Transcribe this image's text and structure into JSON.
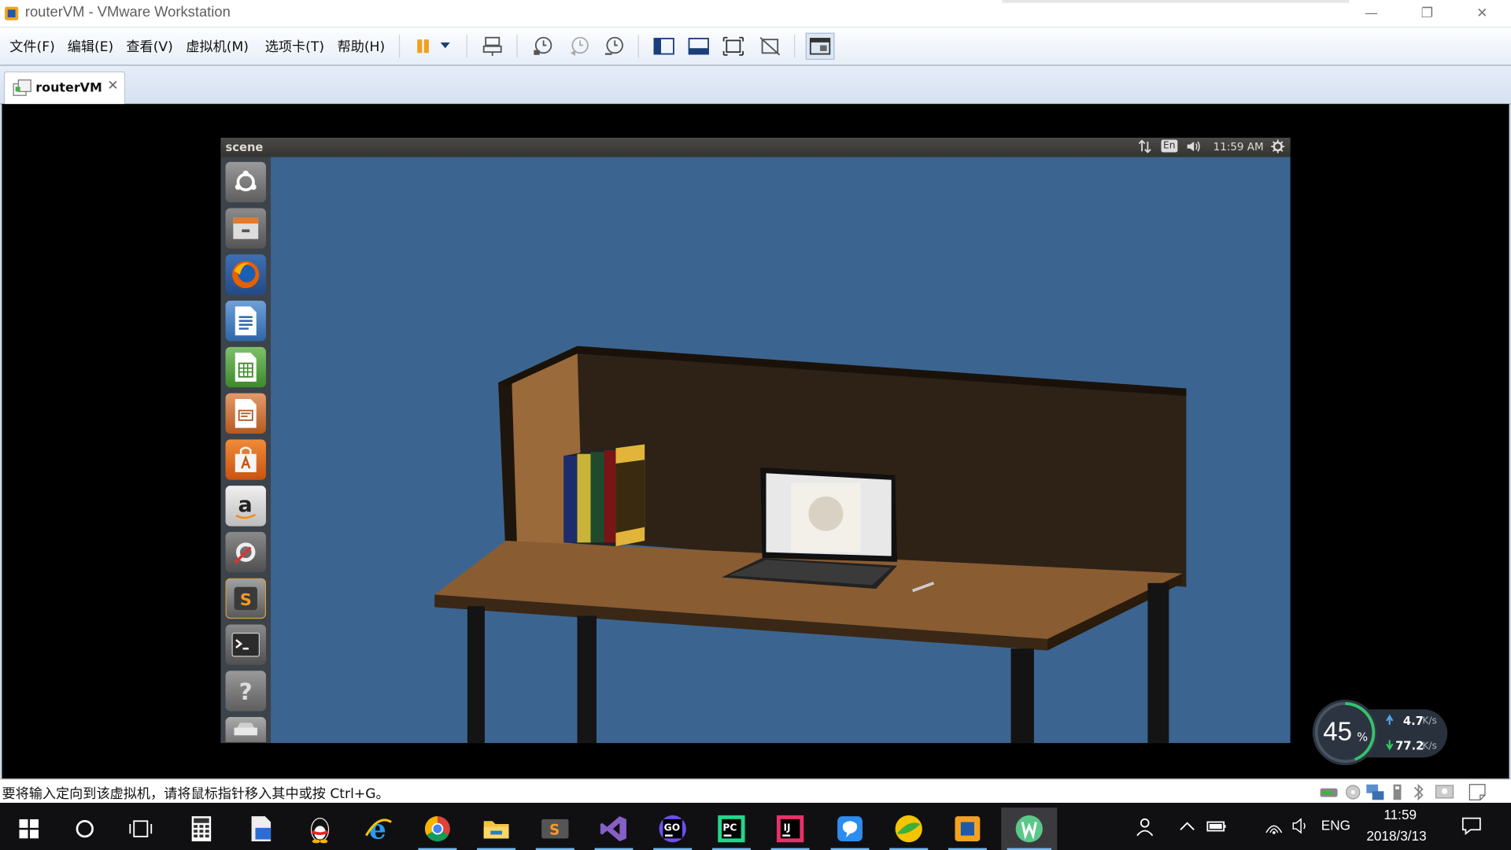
{
  "window": {
    "title": "routerVM - VMware Workstation",
    "minimize": "—",
    "restore": "❐",
    "close": "✕"
  },
  "menu": {
    "items": [
      "文件(F)",
      "编辑(E)",
      "查看(V)",
      "虚拟机(M)",
      "选项卡(T)",
      "帮助(H)"
    ]
  },
  "tabs": [
    {
      "label": "routerVM",
      "close": "✕"
    }
  ],
  "guest": {
    "topbar_title": "scene",
    "lang": "En",
    "time": "11:59 AM"
  },
  "status": {
    "message": "要将输入定向到该虚拟机，请将鼠标指针移入其中或按 Ctrl+G。"
  },
  "net_widget": {
    "percent": "45",
    "percent_unit": "%",
    "upload": "4.7",
    "upload_unit": "K/s",
    "download": "77.2",
    "download_unit": "K/s"
  },
  "taskbar": {
    "lang": "ENG",
    "time": "11:59",
    "date": "2018/3/13"
  },
  "colors": {
    "guest_bg": "#3b6590",
    "accent": "#76b9ed"
  }
}
